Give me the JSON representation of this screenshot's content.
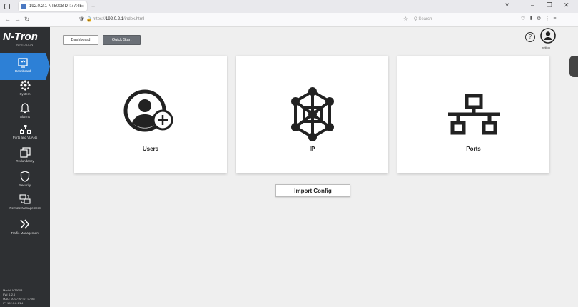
{
  "browser": {
    "tab_title": "192.0.2.1 NT5008 DT:77:4E",
    "tab_close": "×",
    "new_tab": "+",
    "window_controls": {
      "dropdown": "˅",
      "minimize": "–",
      "restore": "❐",
      "close": "✕"
    },
    "nav": {
      "back": "←",
      "forward": "→",
      "reload": "↻"
    },
    "url_prefix": "https://",
    "url_host": "192.0.2.1",
    "url_path": "/index.html",
    "search_placeholder": "Q Search"
  },
  "sidebar": {
    "logo": "N-Tron",
    "logo_sub": "by RED LION",
    "items": [
      {
        "label": "Dashboard",
        "icon": "dashboard-icon",
        "active": true
      },
      {
        "label": "System",
        "icon": "system-icon"
      },
      {
        "label": "Alarms",
        "icon": "bell-icon"
      },
      {
        "label": "Ports and VLANs",
        "icon": "network-icon"
      },
      {
        "label": "Redundancy",
        "icon": "redundancy-icon"
      },
      {
        "label": "Security",
        "icon": "shield-icon"
      },
      {
        "label": "Remote Management",
        "icon": "remote-icon"
      },
      {
        "label": "Traffic Management",
        "icon": "traffic-icon"
      }
    ],
    "device": {
      "model": "Model: NT5008",
      "fw": "FW: 1.2.6",
      "mac": "MAC: 00:07:AF:D7:77:8E",
      "ip": "IP: 192.0.2.1/24"
    }
  },
  "header": {
    "dashboard_button": "Dashboard",
    "quick_start_button": "Quick Start",
    "help_label": "?",
    "username": "netlion"
  },
  "cards": {
    "users": "Users",
    "ip": "IP",
    "ports": "Ports"
  },
  "import_button": "Import Config",
  "colors": {
    "sidebar_bg": "#2e3033",
    "active_blue": "#2d80d6",
    "quick_start_bg": "#6b7077",
    "page_bg": "#efefef"
  }
}
